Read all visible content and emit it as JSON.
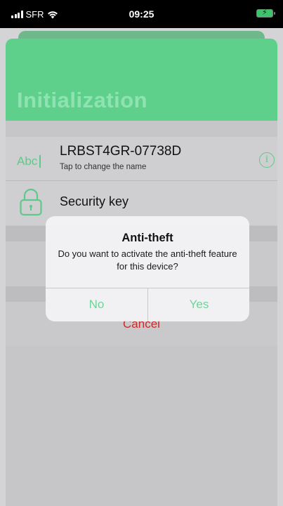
{
  "status_bar": {
    "carrier": "SFR",
    "time": "09:25"
  },
  "header": {
    "title": "Initialization"
  },
  "device": {
    "name": "LRBST4GR-07738D",
    "hint": "Tap to change the name",
    "name_icon_text": "Abc",
    "info_icon_text": "i"
  },
  "security": {
    "label": "Security key"
  },
  "actions": {
    "cancel_label": "Cancel"
  },
  "alert": {
    "title": "Anti-theft",
    "message": "Do you want to activate the anti-theft feature for this device?",
    "no_label": "No",
    "yes_label": "Yes"
  },
  "colors": {
    "accent": "#5fd08c",
    "destructive": "#cc2a2a"
  },
  "icons": [
    "signal-icon",
    "wifi-icon",
    "battery-icon",
    "text-field-icon",
    "info-icon",
    "lock-icon"
  ]
}
